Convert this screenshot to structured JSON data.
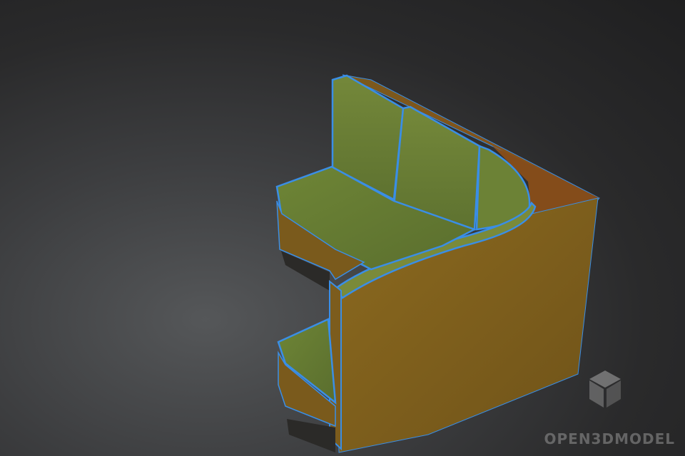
{
  "viewport": {
    "object_name": "corner-sofa-model",
    "colors": {
      "background_center": "#555759",
      "background_edge": "#1f1f20",
      "body": "#8a6a22",
      "body_dark": "#6a4f17",
      "cushion": "#6f8436",
      "wire": "#3a8ee6"
    }
  },
  "watermark": {
    "text": "OPEN3DMODEL",
    "logo_icon": "cube-icon"
  }
}
